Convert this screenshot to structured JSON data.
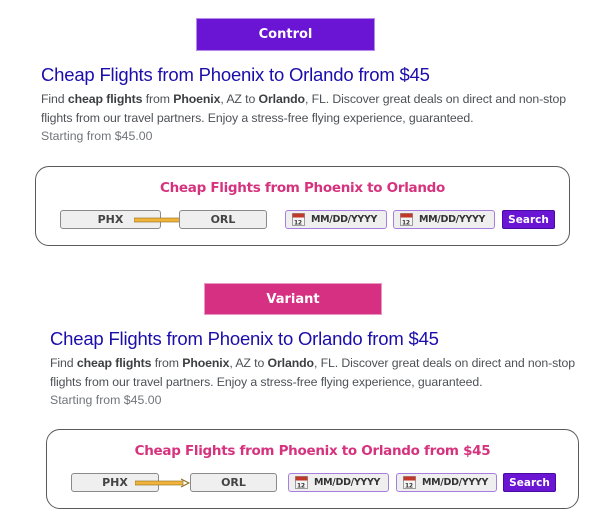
{
  "colors": {
    "control_banner": "#6a14d4",
    "variant_banner": "#d53082",
    "ad_title": "#1a0dab",
    "widget_title": "#d6337f",
    "search_button": "#6a14d4",
    "date_border": "#a77de0",
    "arrow": "#f0b43c"
  },
  "control": {
    "banner_label": "Control",
    "ad": {
      "title": "Cheap Flights from Phoenix to Orlando from $45",
      "desc_parts": [
        "Find ",
        "cheap flights",
        " from ",
        "Phoenix",
        ", AZ to ",
        "Orlando",
        ", FL. Discover great deals on direct and non-stop"
      ],
      "desc_line2": "flights from our travel partners. Enjoy a stress-free flying experience, guaranteed.",
      "price": "Starting from $45.00"
    },
    "widget": {
      "title": "Cheap Flights from Phoenix to Orlando",
      "origin": "PHX",
      "destination": "ORL",
      "depart_placeholder": "MM/DD/YYYY",
      "return_placeholder": "MM/DD/YYYY",
      "search_label": "Search"
    }
  },
  "variant": {
    "banner_label": "Variant",
    "ad": {
      "title": "Cheap Flights from Phoenix to Orlando from $45",
      "desc_parts": [
        "Find ",
        "cheap flights",
        " from ",
        "Phoenix",
        ", AZ to ",
        "Orlando",
        ", FL. Discover great deals on direct and non-stop"
      ],
      "desc_line2": "flights from our travel partners. Enjoy a stress-free flying experience, guaranteed.",
      "price": "Starting from $45.00"
    },
    "widget": {
      "title": "Cheap Flights from Phoenix to Orlando from $45",
      "origin": "PHX",
      "destination": "ORL",
      "depart_placeholder": "MM/DD/YYYY",
      "return_placeholder": "MM/DD/YYYY",
      "search_label": "Search"
    }
  }
}
